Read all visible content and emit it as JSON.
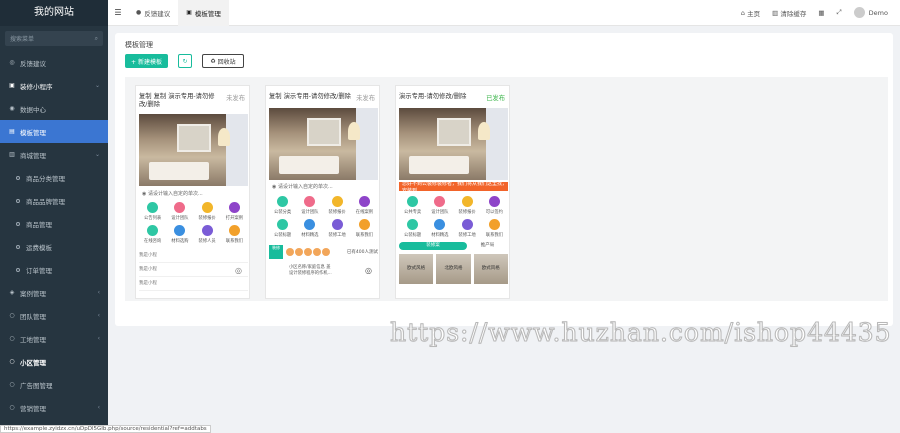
{
  "brand": "我的网站",
  "sidebar": {
    "search_placeholder": "搜索菜单",
    "items": [
      {
        "label": "反馈建议",
        "icon": "feedback-icon"
      },
      {
        "label": "装修小程序",
        "icon": "store-icon"
      },
      {
        "label": "数据中心",
        "icon": "chart-icon"
      },
      {
        "label": "模板管理",
        "icon": "template-icon"
      },
      {
        "label": "商城管理",
        "icon": "cart-icon"
      },
      {
        "label": "商品分类管理"
      },
      {
        "label": "商品品牌管理"
      },
      {
        "label": "商品管理"
      },
      {
        "label": "运费模板"
      },
      {
        "label": "订单管理"
      },
      {
        "label": "案例管理",
        "icon": "case-icon"
      },
      {
        "label": "团队管理",
        "icon": "team-icon"
      },
      {
        "label": "工地管理",
        "icon": "site-icon"
      },
      {
        "label": "小区管理",
        "icon": "community-icon"
      },
      {
        "label": "广告图管理",
        "icon": "ad-icon"
      },
      {
        "label": "营销管理",
        "icon": "marketing-icon"
      }
    ]
  },
  "topbar": {
    "tabs": [
      {
        "label": "反馈建议",
        "icon": "comment-icon"
      },
      {
        "label": "模板管理",
        "icon": "template-icon"
      }
    ],
    "right": {
      "home": "主页",
      "clear_cache": "清除缓存",
      "user": "Demo"
    }
  },
  "content": {
    "title": "模板管理",
    "new_button": "+ 新建模板",
    "recycle_button": "回收站"
  },
  "cards": [
    {
      "title": "复制 复制 演示专用-请勿修改/删除",
      "status": "未发布",
      "notice": "请设计输入自定的单次...",
      "icons": [
        "公告列表",
        "设计团队",
        "装修报价",
        "打开案例",
        "在线咨询",
        "材料选购",
        "装修人员",
        "联系我们"
      ],
      "rows": [
        "我是小程",
        "我是小程",
        "我是小程"
      ]
    },
    {
      "title": "复制 演示专用-请勿修改/删除",
      "status": "未发布",
      "notice": "请设计输入自定的单次...",
      "icons": [
        "公装分类",
        "设计团队",
        "装修报价",
        "在线案例",
        "公装标题",
        "材料精选",
        "装修工地",
        "联系我们"
      ],
      "promo": "已有400人测试",
      "promo_line1": "小区名称/家庭信息 盖",
      "promo_line2": "设计装修程序的作机..."
    },
    {
      "title": "演示专用-请勿修改/删除",
      "status": "已发布",
      "notice": "您好不到公装修装修者，我们将从我们这里找，安装到",
      "icons": [
        "公共专卖",
        "设计团队",
        "装修报价",
        "可以签约",
        "公装标题",
        "材料精选",
        "装修工地",
        "联系我们"
      ],
      "tab_active": "装修案",
      "tab_other": "推产局",
      "thumbs": [
        "欧式风格",
        "北欧风格",
        "欧式风格"
      ]
    }
  ],
  "status_url": "https://example.zyidzx.cn/uDpDl5GIb.php/source/residential?ref=addtabs",
  "watermark": "https://www.huzhan.com/ishop44435",
  "colors": {
    "accent": "#18bc9c",
    "sidebar": "#263540",
    "active": "#3b76d2"
  }
}
